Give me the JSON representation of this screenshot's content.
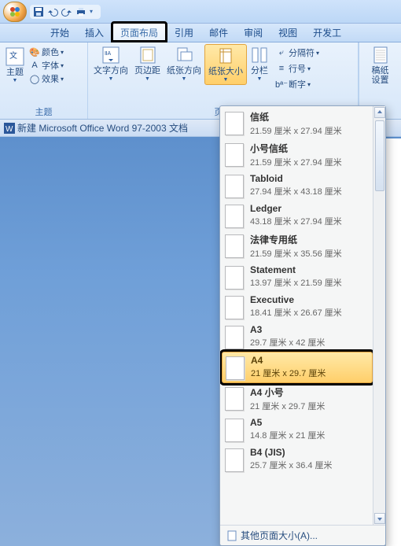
{
  "titlebar": {
    "qat_dropdown_glyph": "▾"
  },
  "tabs": {
    "items": [
      "开始",
      "插入",
      "页面布局",
      "引用",
      "邮件",
      "审阅",
      "视图",
      "开发工"
    ],
    "active_index": 2
  },
  "ribbon": {
    "theme": {
      "main_label": "主题",
      "sub": [
        "颜色",
        "字体",
        "效果"
      ],
      "group_label": "主题"
    },
    "pagesetup": {
      "text_direction": "文字方向",
      "margins": "页边距",
      "paper_orient": "纸张方向",
      "paper_size": "纸张大小",
      "columns": "分栏",
      "breaks": "分隔符",
      "line_numbers": "行号",
      "hyphenation": "断字",
      "group_label": "页面"
    },
    "writing": {
      "label": "稿纸",
      "sub": "设置"
    }
  },
  "docbar": {
    "title": "新建 Microsoft Office Word 97-2003 文档"
  },
  "dropdown": {
    "items": [
      {
        "name": "信纸",
        "dim": "21.59 厘米 x 27.94 厘米"
      },
      {
        "name": "小号信纸",
        "dim": "21.59 厘米 x 27.94 厘米"
      },
      {
        "name": "Tabloid",
        "dim": "27.94 厘米 x 43.18 厘米"
      },
      {
        "name": "Ledger",
        "dim": "43.18 厘米 x 27.94 厘米"
      },
      {
        "name": "法律专用纸",
        "dim": "21.59 厘米 x 35.56 厘米"
      },
      {
        "name": "Statement",
        "dim": "13.97 厘米 x 21.59 厘米"
      },
      {
        "name": "Executive",
        "dim": "18.41 厘米 x 26.67 厘米"
      },
      {
        "name": "A3",
        "dim": "29.7 厘米 x 42 厘米"
      },
      {
        "name": "A4",
        "dim": "21 厘米 x 29.7 厘米"
      },
      {
        "name": "A4 小号",
        "dim": "21 厘米 x 29.7 厘米"
      },
      {
        "name": "A5",
        "dim": "14.8 厘米 x 21 厘米"
      },
      {
        "name": "B4 (JIS)",
        "dim": "25.7 厘米 x 36.4 厘米"
      }
    ],
    "selected_index": 8,
    "footer": "其他页面大小(A)...",
    "footer_key": "A"
  }
}
